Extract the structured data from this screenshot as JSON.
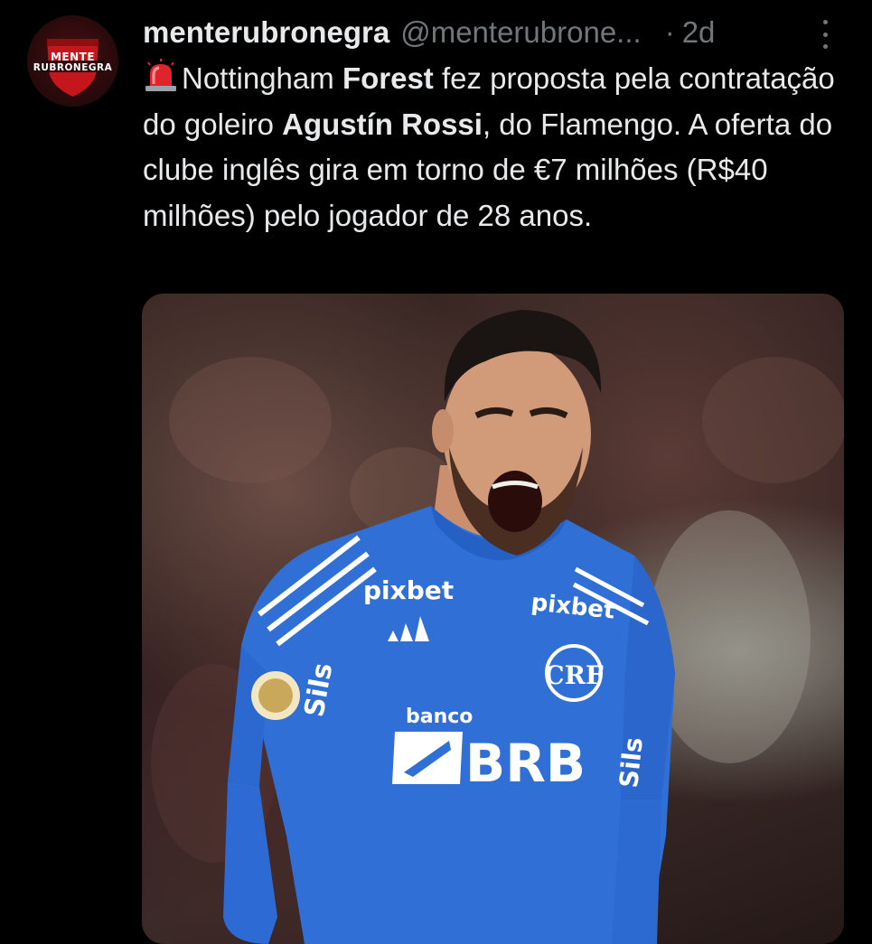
{
  "account": {
    "display_name": "menterubronegra",
    "handle": "@menterubrone...",
    "separator": "·",
    "time": "2d",
    "avatar_text_line1": "MENTE",
    "avatar_text_line2": "RUBRONEGRA"
  },
  "tweet": {
    "emoji_icon": "police-siren-icon",
    "p1": "Nottingham ",
    "b1": "Forest",
    "p2": " fez proposta pela contratação do goleiro ",
    "b2": "Agustín Rossi",
    "p3": ", do Flamengo. A oferta do clube inglês gira em torno de €7 milhões (R$40 milhões) pelo jogador de 28 anos."
  },
  "media": {
    "jersey_sponsor_top": "pixbet",
    "jersey_sponsor_right": "pixbet",
    "jersey_bank_label": "banco",
    "jersey_bank_name": "BRB",
    "jersey_sleeve_text": "Sils",
    "crest_text": "CRF"
  },
  "colors": {
    "background": "#000000",
    "text_primary": "#e7e9ea",
    "text_secondary": "#71767b",
    "jersey_blue": "#2f6fd6"
  }
}
